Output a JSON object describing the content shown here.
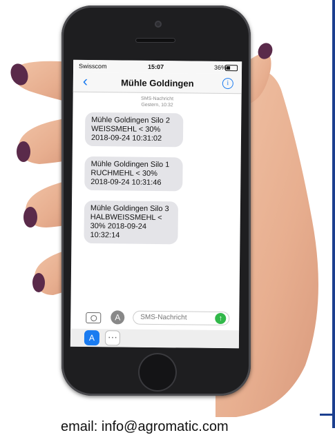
{
  "status_bar": {
    "carrier": "Swisscom",
    "time": "15:07",
    "battery": "36%"
  },
  "nav": {
    "back_icon": "chevron-left-icon",
    "title": "Mühle Goldingen",
    "info_icon": "info-icon"
  },
  "conversation": {
    "service_label": "SMS-Nachricht",
    "date_label": "Gestern, 10:32",
    "messages": [
      {
        "lines": [
          "Mühle Goldingen Silo 2",
          "WEISSMEHL < 30%",
          "2018-09-24 10:31:02"
        ]
      },
      {
        "lines": [
          "Mühle Goldingen Silo 1",
          "RUCHMEHL < 30%",
          "2018-09-24 10:31:46"
        ]
      },
      {
        "lines": [
          "Mühle Goldingen Silo 3",
          "HALBWEISSMEHL <",
          "30% 2018-09-24",
          "10:32:14"
        ]
      }
    ]
  },
  "composer": {
    "placeholder": "SMS-Nachricht",
    "camera_icon": "camera-icon",
    "appstore_icon": "appstore-icon",
    "send_icon": "send-arrow-icon"
  },
  "app_drawer": {
    "items": [
      "appstore-icon",
      "more-icon"
    ]
  },
  "footer": {
    "email": "email: info@agromatic.com"
  },
  "colors": {
    "ios_blue": "#1a7bf0",
    "bubble_gray": "#e4e4e8",
    "send_green": "#32b84a",
    "frame_blue": "#1b3f8f"
  }
}
